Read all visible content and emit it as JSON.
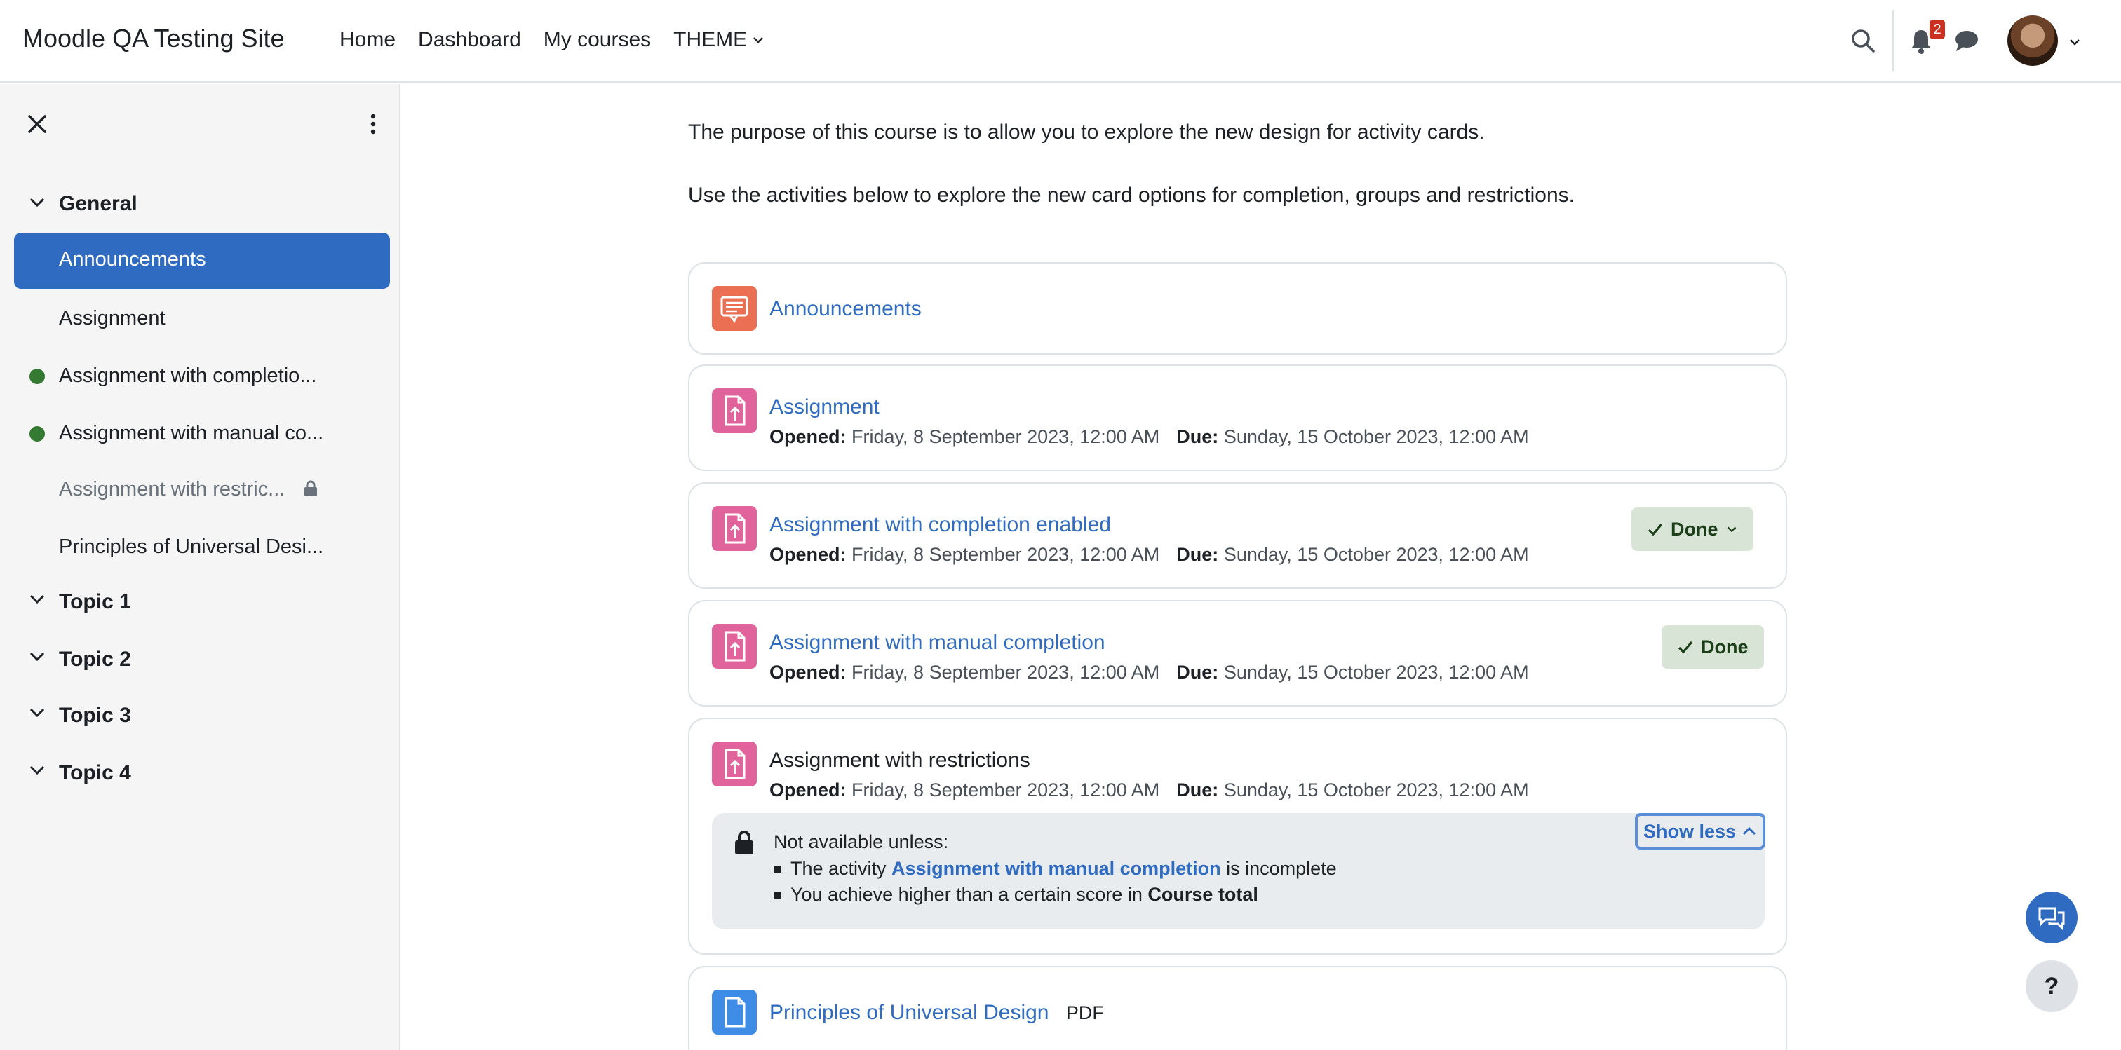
{
  "site": {
    "brand": "Moodle QA Testing Site"
  },
  "nav": {
    "links": [
      "Home",
      "Dashboard",
      "My courses"
    ],
    "theme_label": "THEME",
    "notification_count": "2"
  },
  "drawer": {
    "sections": [
      {
        "title": "General"
      },
      {
        "title": "Topic 1"
      },
      {
        "title": "Topic 2"
      },
      {
        "title": "Topic 3"
      },
      {
        "title": "Topic 4"
      }
    ],
    "items": [
      {
        "label": "Announcements"
      },
      {
        "label": "Assignment"
      },
      {
        "label": "Assignment with completio..."
      },
      {
        "label": "Assignment with manual co..."
      },
      {
        "label": "Assignment with restric..."
      },
      {
        "label": "Principles of Universal Desi..."
      }
    ]
  },
  "main": {
    "intro1": "The purpose of this course is to allow you to explore the new design for activity cards.",
    "intro2": "Use the activities below to explore the new card options for completion, groups and restrictions.",
    "opened_label": "Opened:",
    "due_label": "Due:",
    "opened_value": "Friday, 8 September 2023, 12:00 AM",
    "due_value": "Sunday, 15 October 2023, 12:00 AM",
    "activities": [
      {
        "title": "Announcements"
      },
      {
        "title": "Assignment"
      },
      {
        "title": "Assignment with completion enabled",
        "status": "Done"
      },
      {
        "title": "Assignment with manual completion",
        "status": "Done"
      },
      {
        "title": "Assignment with restrictions"
      },
      {
        "title": "Principles of Universal Design",
        "tag": "PDF"
      }
    ],
    "restriction": {
      "heading": "Not available unless:",
      "line1_pre": "The activity ",
      "line1_link": "Assignment with manual completion",
      "line1_post": " is incomplete",
      "line2_pre": "You achieve higher than a certain score in ",
      "line2_bold": "Course total",
      "toggle": "Show less"
    }
  },
  "floating": {
    "help": "?"
  }
}
